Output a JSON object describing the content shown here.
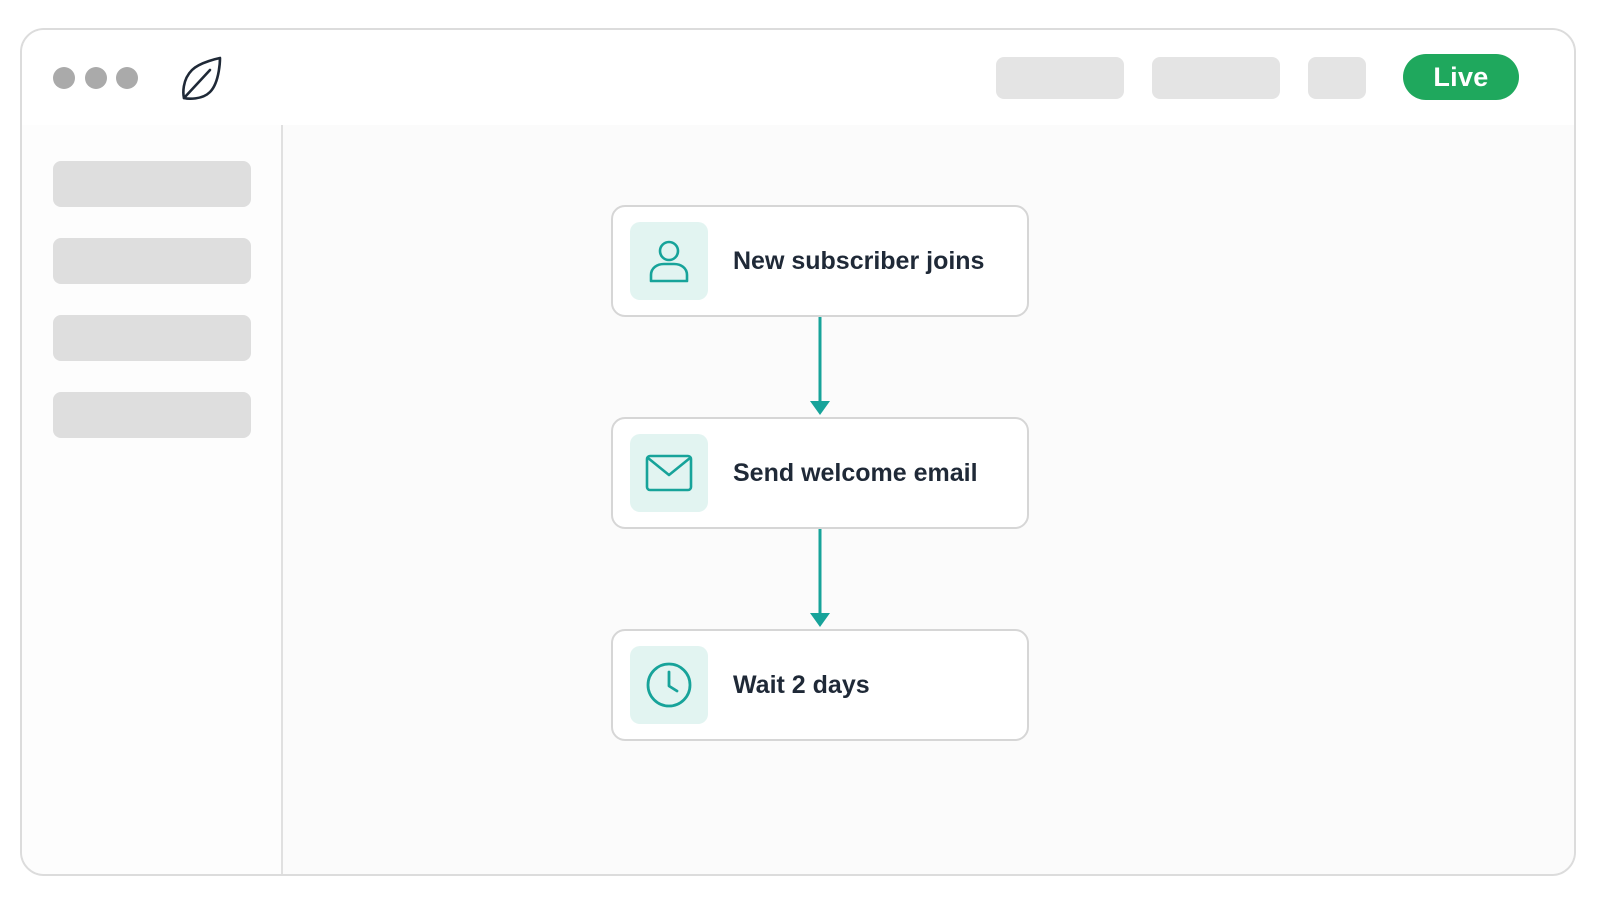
{
  "header": {
    "window_controls": [
      "dot",
      "dot",
      "dot"
    ],
    "logo_icon": "leaf-icon",
    "status_badge": "Live",
    "status_color": "#1fa85d"
  },
  "workflow": {
    "accent_color": "#17a39a",
    "steps": [
      {
        "icon": "user-icon",
        "label": "New subscriber joins"
      },
      {
        "icon": "mail-icon",
        "label": "Send welcome email"
      },
      {
        "icon": "clock-icon",
        "label": "Wait 2 days"
      }
    ]
  }
}
